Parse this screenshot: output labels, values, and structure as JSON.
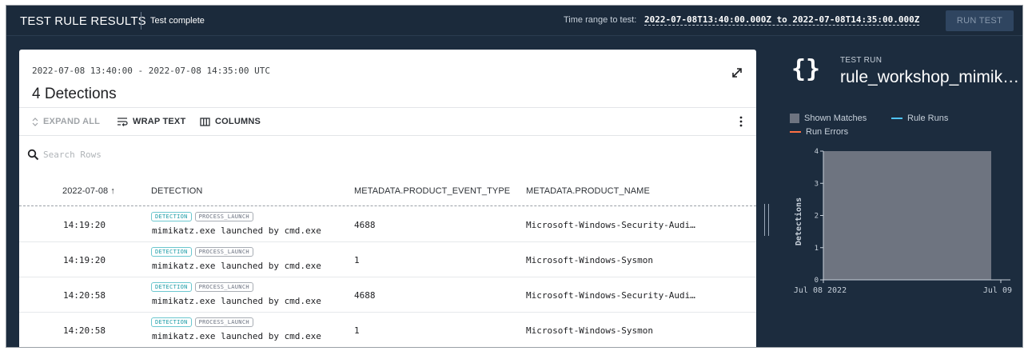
{
  "header": {
    "title": "TEST RULE RESULTS",
    "status": "Test complete",
    "time_range_label": "Time range to test:",
    "time_range_value": "2022-07-08T13:40:00.000Z to 2022-07-08T14:35:00.000Z",
    "run_test_label": "RUN TEST"
  },
  "results": {
    "range_text": "2022-07-08 13:40:00 - 2022-07-08 14:35:00 UTC",
    "detections_title": "4 Detections",
    "toolbar": {
      "expand_all": "EXPAND ALL",
      "wrap_text": "WRAP TEXT",
      "columns": "COLUMNS"
    },
    "search_placeholder": "Search Rows",
    "table": {
      "columns": [
        "2022-07-08 ↑",
        "DETECTION",
        "METADATA.PRODUCT_EVENT_TYPE",
        "METADATA.PRODUCT_NAME"
      ],
      "rows": [
        {
          "time": "14:19:20",
          "chips": [
            "DETECTION",
            "PROCESS_LAUNCH"
          ],
          "detection": "mimikatz.exe launched by cmd.exe",
          "event_type": "4688",
          "product_name": "Microsoft-Windows-Security-Audi…"
        },
        {
          "time": "14:19:20",
          "chips": [
            "DETECTION",
            "PROCESS_LAUNCH"
          ],
          "detection": "mimikatz.exe launched by cmd.exe",
          "event_type": "1",
          "product_name": "Microsoft-Windows-Sysmon"
        },
        {
          "time": "14:20:58",
          "chips": [
            "DETECTION",
            "PROCESS_LAUNCH"
          ],
          "detection": "mimikatz.exe launched by cmd.exe",
          "event_type": "4688",
          "product_name": "Microsoft-Windows-Security-Audi…"
        },
        {
          "time": "14:20:58",
          "chips": [
            "DETECTION",
            "PROCESS_LAUNCH"
          ],
          "detection": "mimikatz.exe launched by cmd.exe",
          "event_type": "1",
          "product_name": "Microsoft-Windows-Sysmon"
        }
      ]
    }
  },
  "test_run": {
    "label": "TEST RUN",
    "name": "rule_workshop_mimik…",
    "legend": {
      "shown_matches": "Shown Matches",
      "rule_runs": "Rule Runs",
      "run_errors": "Run Errors"
    }
  },
  "colors": {
    "shown_matches": "#6e7480",
    "rule_runs": "#4fc3f7",
    "run_errors": "#ff7043"
  },
  "chart_data": {
    "type": "bar",
    "categories": [
      "Jul 08 2022",
      "Jul 09"
    ],
    "x_tick_labels": [
      "Jul 08 2022",
      "Jul 09"
    ],
    "series": [
      {
        "name": "Shown Matches",
        "values": [
          4
        ]
      }
    ],
    "ylabel": "Detections",
    "xlabel": "",
    "ylim": [
      0,
      4
    ],
    "y_ticks": [
      0,
      1,
      2,
      3,
      4
    ],
    "legend_position": "top-left",
    "grid": false
  }
}
